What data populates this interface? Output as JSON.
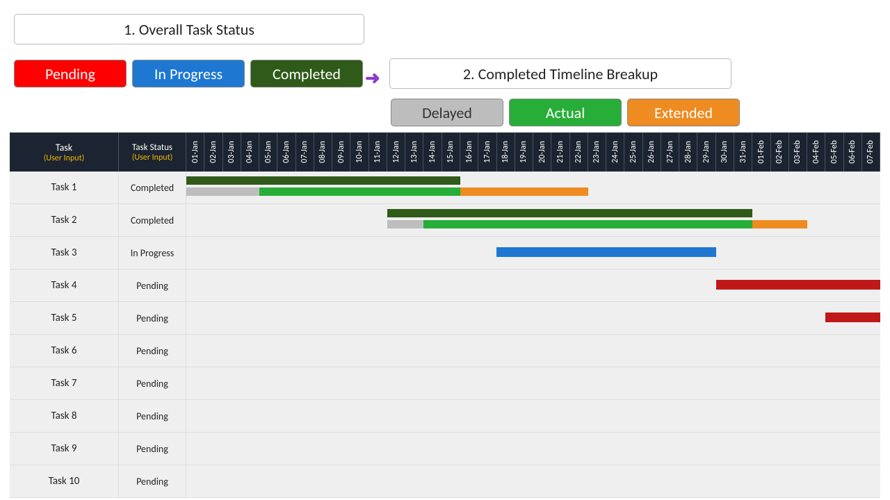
{
  "headings": {
    "overall": "1. Overall Task Status",
    "breakup": "2. Completed Timeline Breakup"
  },
  "legend_overall": {
    "pending": "Pending",
    "inprogress": "In Progress",
    "completed": "Completed"
  },
  "legend_breakup": {
    "delayed": "Delayed",
    "actual": "Actual",
    "extended": "Extended"
  },
  "columns": {
    "task": "Task",
    "task_sub": "(User Input)",
    "status": "Task Status",
    "status_sub": "(User Input)"
  },
  "dates": [
    "01-Jan",
    "02-Jan",
    "03-Jan",
    "04-Jan",
    "05-Jan",
    "06-Jan",
    "07-Jan",
    "08-Jan",
    "09-Jan",
    "10-Jan",
    "11-Jan",
    "12-Jan",
    "13-Jan",
    "14-Jan",
    "15-Jan",
    "16-Jan",
    "17-Jan",
    "18-Jan",
    "19-Jan",
    "20-Jan",
    "21-Jan",
    "22-Jan",
    "23-Jan",
    "24-Jan",
    "25-Jan",
    "26-Jan",
    "27-Jan",
    "28-Jan",
    "29-Jan",
    "30-Jan",
    "31-Jan",
    "01-Feb",
    "02-Feb",
    "03-Feb",
    "04-Feb",
    "05-Feb",
    "06-Feb",
    "07-Feb"
  ],
  "tasks": [
    {
      "name": "Task 1",
      "status": "Completed"
    },
    {
      "name": "Task 2",
      "status": "Completed"
    },
    {
      "name": "Task 3",
      "status": "In Progress"
    },
    {
      "name": "Task 4",
      "status": "Pending"
    },
    {
      "name": "Task 5",
      "status": "Pending"
    },
    {
      "name": "Task 6",
      "status": "Pending"
    },
    {
      "name": "Task 7",
      "status": "Pending"
    },
    {
      "name": "Task 8",
      "status": "Pending"
    },
    {
      "name": "Task 9",
      "status": "Pending"
    },
    {
      "name": "Task 10",
      "status": "Pending"
    }
  ],
  "chart_data": {
    "type": "gantt",
    "x_axis": {
      "start": "01-Jan",
      "end": "07-Feb",
      "n_days": 38
    },
    "series_colors": {
      "completed": "#2f5a19",
      "delayed": "#bdbdbd",
      "actual": "#27ae38",
      "extended": "#ee8b21",
      "in_progress": "#1e78d2",
      "pending": "#c01818"
    },
    "rows": [
      {
        "task": "Task 1",
        "status": "Completed",
        "bars": [
          {
            "type": "completed",
            "start": 0,
            "end": 15,
            "track": 1
          },
          {
            "type": "delayed",
            "start": 0,
            "end": 4,
            "track": 2
          },
          {
            "type": "actual",
            "start": 4,
            "end": 15,
            "track": 2
          },
          {
            "type": "extended",
            "start": 15,
            "end": 22,
            "track": 2
          }
        ]
      },
      {
        "task": "Task 2",
        "status": "Completed",
        "bars": [
          {
            "type": "completed",
            "start": 11,
            "end": 31,
            "track": 1
          },
          {
            "type": "delayed",
            "start": 11,
            "end": 13,
            "track": 2
          },
          {
            "type": "actual",
            "start": 13,
            "end": 31,
            "track": 2
          },
          {
            "type": "extended",
            "start": 31,
            "end": 34,
            "track": 2
          }
        ]
      },
      {
        "task": "Task 3",
        "status": "In Progress",
        "bars": [
          {
            "type": "in_progress",
            "start": 17,
            "end": 29,
            "track": "single"
          }
        ]
      },
      {
        "task": "Task 4",
        "status": "Pending",
        "bars": [
          {
            "type": "pending",
            "start": 29,
            "end": 38,
            "track": "single"
          }
        ]
      },
      {
        "task": "Task 5",
        "status": "Pending",
        "bars": [
          {
            "type": "pending",
            "start": 35,
            "end": 38,
            "track": "single"
          }
        ]
      },
      {
        "task": "Task 6",
        "status": "Pending",
        "bars": []
      },
      {
        "task": "Task 7",
        "status": "Pending",
        "bars": []
      },
      {
        "task": "Task 8",
        "status": "Pending",
        "bars": []
      },
      {
        "task": "Task 9",
        "status": "Pending",
        "bars": []
      },
      {
        "task": "Task 10",
        "status": "Pending",
        "bars": []
      }
    ]
  }
}
